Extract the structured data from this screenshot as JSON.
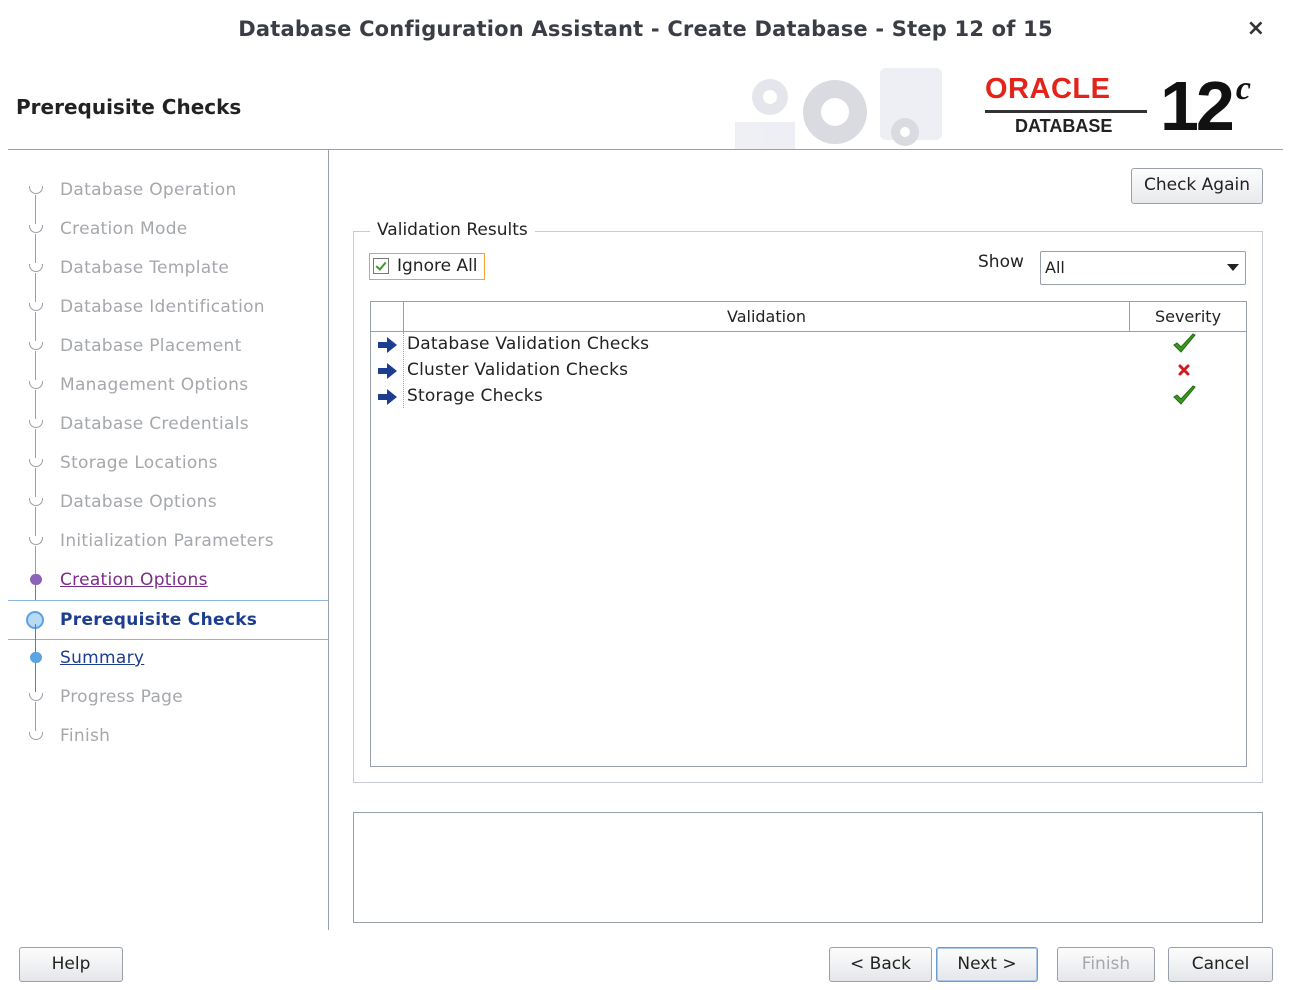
{
  "window": {
    "title": "Database Configuration Assistant - Create Database - Step 12 of 15",
    "close_glyph": "×"
  },
  "header": {
    "page_title": "Prerequisite Checks",
    "logo_brand": "ORACLE",
    "logo_product": "DATABASE",
    "logo_version": "12",
    "logo_version_suffix": "c"
  },
  "nav": {
    "items": [
      {
        "label": "Database Operation",
        "state": "disabled"
      },
      {
        "label": "Creation Mode",
        "state": "disabled"
      },
      {
        "label": "Database Template",
        "state": "disabled"
      },
      {
        "label": "Database Identification",
        "state": "disabled"
      },
      {
        "label": "Database Placement",
        "state": "disabled"
      },
      {
        "label": "Management Options",
        "state": "disabled"
      },
      {
        "label": "Database Credentials",
        "state": "disabled"
      },
      {
        "label": "Storage Locations",
        "state": "disabled"
      },
      {
        "label": "Database Options",
        "state": "disabled"
      },
      {
        "label": "Initialization Parameters",
        "state": "disabled"
      },
      {
        "label": "Creation Options",
        "state": "visited"
      },
      {
        "label": "Prerequisite Checks",
        "state": "current"
      },
      {
        "label": "Summary",
        "state": "link"
      },
      {
        "label": "Progress Page",
        "state": "disabled"
      },
      {
        "label": "Finish",
        "state": "disabled"
      }
    ]
  },
  "main": {
    "check_again_label": "Check Again",
    "group_title": "Validation Results",
    "ignore_all": {
      "label": "Ignore All",
      "checked": true
    },
    "show": {
      "label": "Show",
      "selected": "All"
    },
    "table": {
      "columns": [
        "Validation",
        "Severity"
      ],
      "rows": [
        {
          "name": "Database Validation Checks",
          "severity": "passed"
        },
        {
          "name": "Cluster Validation Checks",
          "severity": "failed"
        },
        {
          "name": "Storage Checks",
          "severity": "passed"
        }
      ]
    },
    "description": ""
  },
  "footer": {
    "help_label": "Help",
    "back_label": "< Back",
    "next_label": "Next >",
    "finish_label": "Finish",
    "cancel_label": "Cancel"
  },
  "colors": {
    "accent_blue": "#1d3d91",
    "visited_purple": "#7b2c88",
    "oracle_red": "#e3241b",
    "pass_green": "#3b9a23",
    "fail_red": "#d01c1c"
  }
}
